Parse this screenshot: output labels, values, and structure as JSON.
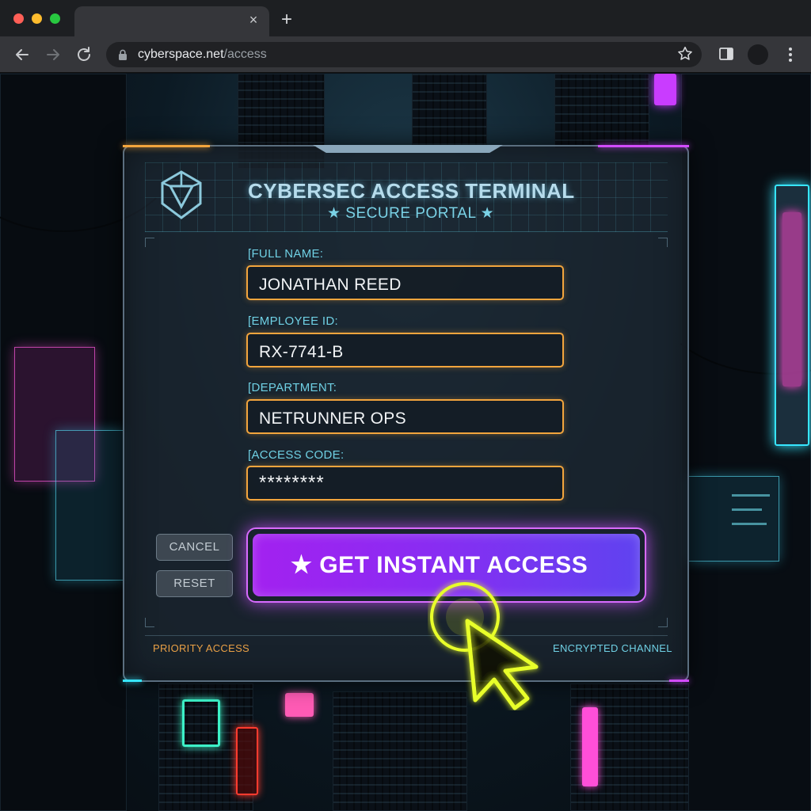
{
  "browser": {
    "url_domain": "cyberspace.net",
    "url_path": "/access",
    "tab_close_glyph": "×",
    "new_tab_glyph": "+",
    "icons": [
      "back-arrow-icon",
      "forward-arrow-icon",
      "reload-icon",
      "lock-icon",
      "bookmark-star-icon",
      "side-panel-icon",
      "profile-avatar",
      "kebab-menu-icon"
    ]
  },
  "panel": {
    "title": "CYBERSEC ACCESS TERMINAL",
    "subtitle": "★ SECURE PORTAL ★",
    "logo_icon": "shield-triangle-logo-icon"
  },
  "form": {
    "fields": [
      {
        "label": "[FULL NAME:",
        "value": "JONATHAN REED"
      },
      {
        "label": "[EMPLOYEE ID:",
        "value": "RX-7741-B"
      },
      {
        "label": "[DEPARTMENT:",
        "value": "NETRUNNER OPS"
      },
      {
        "label": "[ACCESS CODE:",
        "value": "********"
      }
    ],
    "cancel_label": "CANCEL",
    "reset_label": "RESET",
    "submit_label": "★ GET INSTANT ACCESS"
  },
  "footer": {
    "left": "PRIORITY ACCESS",
    "right": "ENCRYPTED CHANNEL"
  },
  "colors": {
    "field_border": "#f3a53d",
    "cta_start": "#a321f0",
    "cta_end": "#5f43f0",
    "cyan_text": "#6fd0e4",
    "cursor": "#e8ff2a"
  }
}
